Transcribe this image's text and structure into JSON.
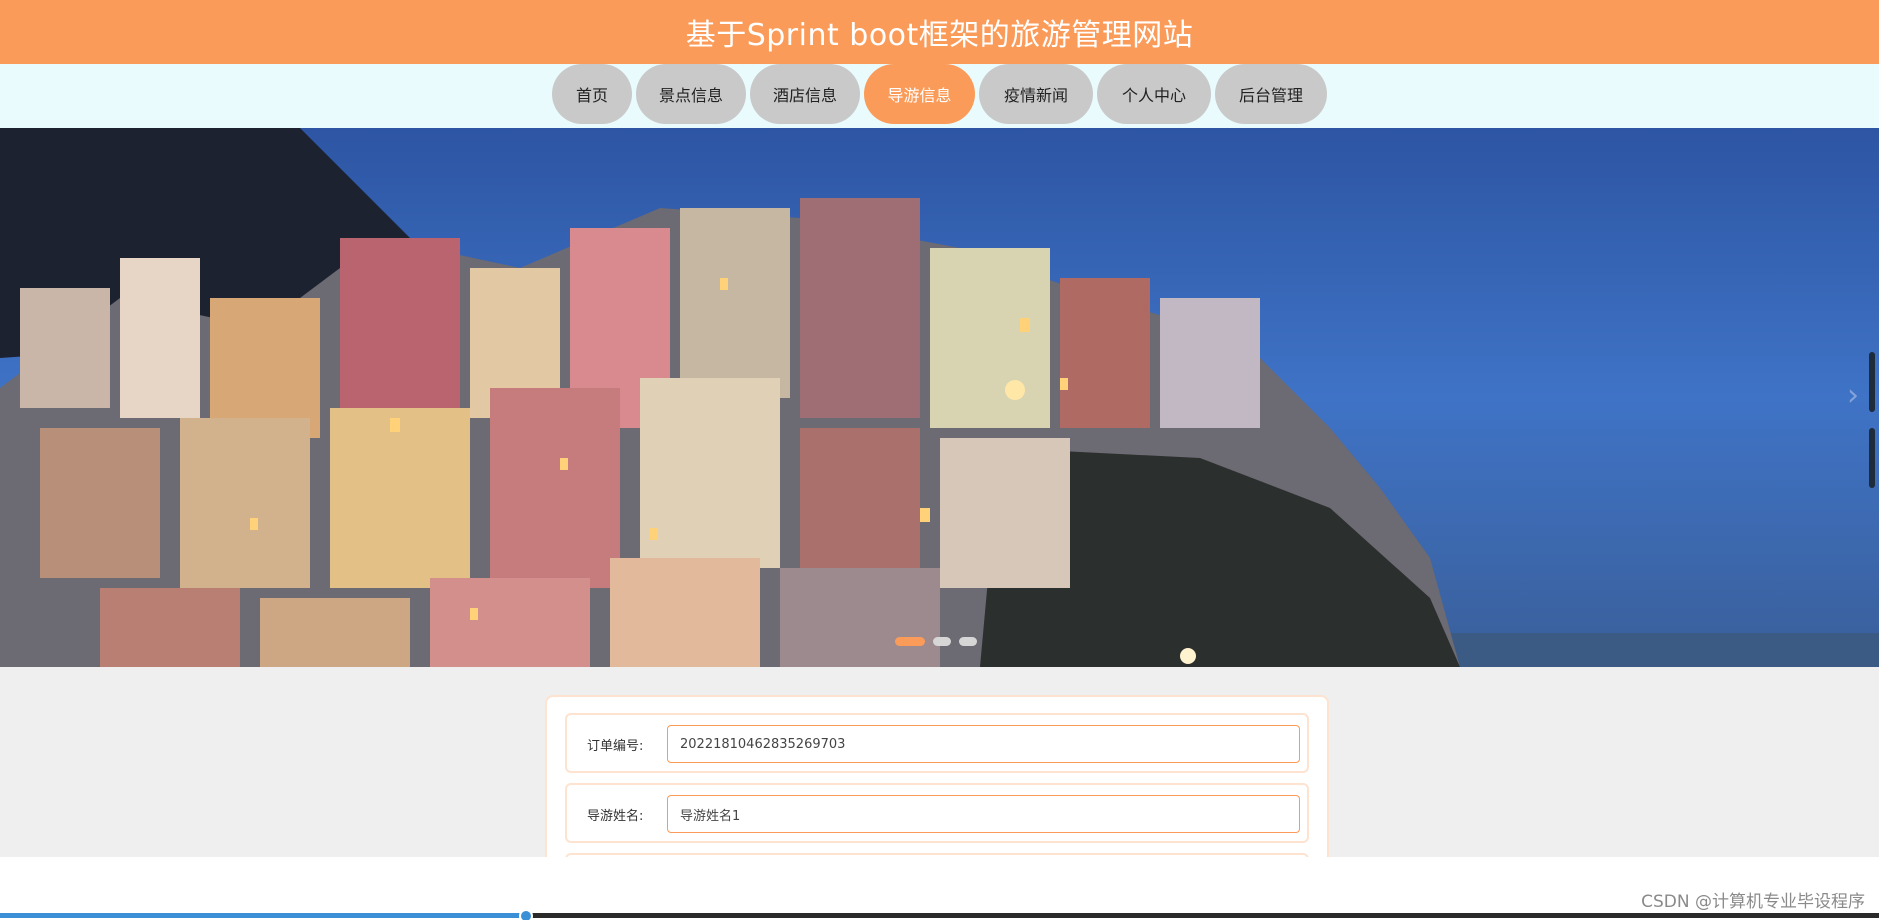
{
  "header": {
    "title": "基于Sprint boot框架的旅游管理网站"
  },
  "nav": {
    "items": [
      {
        "label": "首页",
        "active": false
      },
      {
        "label": "景点信息",
        "active": false
      },
      {
        "label": "酒店信息",
        "active": false
      },
      {
        "label": "导游信息",
        "active": true
      },
      {
        "label": "疫情新闻",
        "active": false
      },
      {
        "label": "个人中心",
        "active": false
      },
      {
        "label": "后台管理",
        "active": false
      }
    ]
  },
  "banner": {
    "next_icon": "chevron-right-icon",
    "slide_count": 3,
    "active_slide": 1
  },
  "form": {
    "fields": [
      {
        "label": "订单编号:",
        "value": "20221810462835269703"
      },
      {
        "label": "导游姓名:",
        "value": "导游姓名1"
      }
    ]
  },
  "player": {
    "progress": 0.28
  },
  "watermark": {
    "text": "CSDN @计算机专业毕设程序"
  },
  "colors": {
    "accent": "#fb9b59",
    "nav_bg": "#e9fbfd",
    "inactive": "#c9c9c9"
  }
}
